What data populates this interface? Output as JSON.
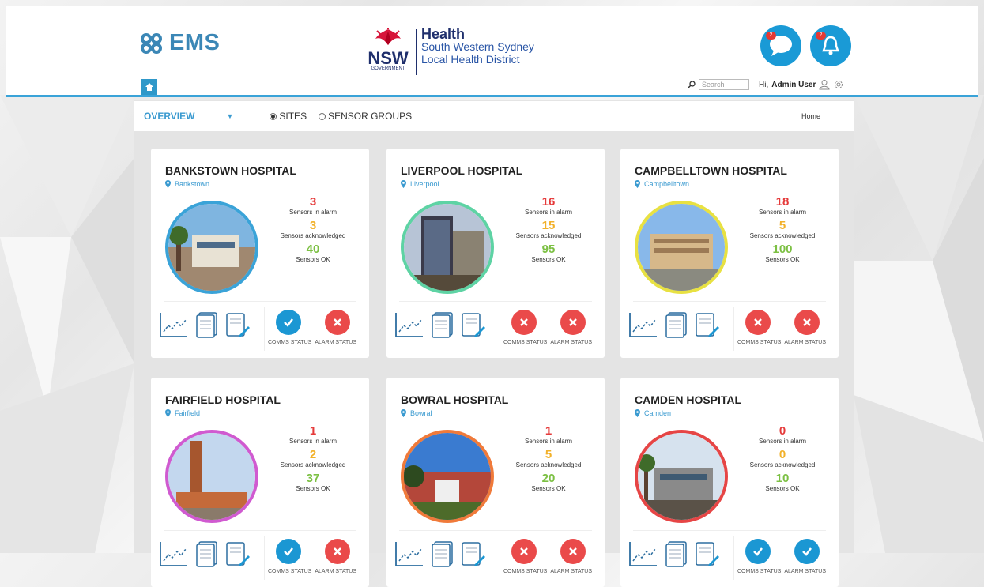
{
  "app": {
    "logo_text": "EMS"
  },
  "brand": {
    "nsw": "NSW",
    "government": "GOVERNMENT",
    "health": "Health",
    "district_line1": "South Western Sydney",
    "district_line2": "Local Health District"
  },
  "header": {
    "chat_badge": "2",
    "alert_badge": "2",
    "search_placeholder": "Search",
    "greeting": "Hi,",
    "user_name": "Admin User"
  },
  "subnav": {
    "overview": "OVERVIEW",
    "sites": "SITES",
    "sensor_groups": "SENSOR GROUPS",
    "selected": "SITES",
    "breadcrumb": "Home"
  },
  "labels": {
    "alarm": "Sensors in alarm",
    "ack": "Sensors acknowledged",
    "ok": "Sensors OK",
    "comms": "COMMS STATUS",
    "alarm_status": "ALARM STATUS"
  },
  "hospitals": [
    {
      "name": "BANKSTOWN HOSPITAL",
      "location": "Bankstown",
      "alarm": "3",
      "ack": "3",
      "ok": "40",
      "comms": "ok",
      "alarm_state": "error",
      "ring": "#3aa3d8"
    },
    {
      "name": "LIVERPOOL HOSPITAL",
      "location": "Liverpool",
      "alarm": "16",
      "ack": "15",
      "ok": "95",
      "comms": "error",
      "alarm_state": "error",
      "ring": "#5ed3a4"
    },
    {
      "name": "CAMPBELLTOWN HOSPITAL",
      "location": "Campbelltown",
      "alarm": "18",
      "ack": "5",
      "ok": "100",
      "comms": "error",
      "alarm_state": "error",
      "ring": "#e8e142"
    },
    {
      "name": "FAIRFIELD HOSPITAL",
      "location": "Fairfield",
      "alarm": "1",
      "ack": "2",
      "ok": "37",
      "comms": "ok",
      "alarm_state": "error",
      "ring": "#d05ad0"
    },
    {
      "name": "BOWRAL HOSPITAL",
      "location": "Bowral",
      "alarm": "1",
      "ack": "5",
      "ok": "20",
      "comms": "error",
      "alarm_state": "error",
      "ring": "#f07a3a"
    },
    {
      "name": "CAMDEN HOSPITAL",
      "location": "Camden",
      "alarm": "0",
      "ack": "0",
      "ok": "10",
      "comms": "ok",
      "alarm_state": "ok",
      "ring": "#e64545"
    }
  ]
}
